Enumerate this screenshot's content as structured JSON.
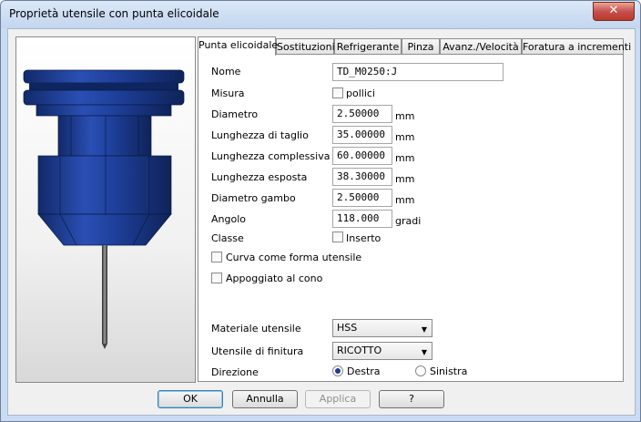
{
  "window": {
    "title": "Proprietà utensile con punta elicoidale",
    "close_glyph": "✕"
  },
  "tabs": [
    {
      "label": "Punta elicoidale",
      "active": true
    },
    {
      "label": "Sostituzioni"
    },
    {
      "label": "Refrigerante"
    },
    {
      "label": "Pinza"
    },
    {
      "label": "Avanz./Velocità"
    },
    {
      "label": "Foratura a incrementi"
    }
  ],
  "form": {
    "nome": {
      "label": "Nome",
      "value": "TD_M0250:J"
    },
    "misura": {
      "label": "Misura",
      "checkbox_label": "pollici",
      "checked": false
    },
    "diametro": {
      "label": "Diametro",
      "value": "2.50000",
      "unit": "mm"
    },
    "lunghezza_taglio": {
      "label": "Lunghezza di taglio",
      "value": "35.00000",
      "unit": "mm"
    },
    "lunghezza_complessiva": {
      "label": "Lunghezza complessiva",
      "value": "60.00000",
      "unit": "mm"
    },
    "lunghezza_esposta": {
      "label": "Lunghezza esposta",
      "value": "38.30000",
      "unit": "mm"
    },
    "diametro_gambo": {
      "label": "Diametro gambo",
      "value": "2.50000",
      "unit": "mm"
    },
    "angolo": {
      "label": "Angolo",
      "value": "118.000",
      "unit": "gradi"
    },
    "classe": {
      "label": "Classe",
      "checkbox_label": "Inserto",
      "checked": false
    },
    "curva": {
      "label": "Curva come forma utensile",
      "checked": false
    },
    "appoggiato": {
      "label": "Appoggiato al cono",
      "checked": false
    },
    "materiale": {
      "label": "Materiale utensile",
      "selected": "HSS"
    },
    "finitura": {
      "label": "Utensile di finitura",
      "selected": "RICOTTO"
    },
    "direzione": {
      "label": "Direzione",
      "options": [
        {
          "label": "Destra",
          "selected": true
        },
        {
          "label": "Sinistra",
          "selected": false
        }
      ]
    }
  },
  "buttons": {
    "ok": "OK",
    "annulla": "Annulla",
    "applica": "Applica",
    "help": "?"
  },
  "icons": {
    "dropdown": "▼"
  },
  "colors": {
    "tool_blue": "#1f3d93",
    "title_bar": "#c9dcf3",
    "close_red": "#c75050"
  }
}
